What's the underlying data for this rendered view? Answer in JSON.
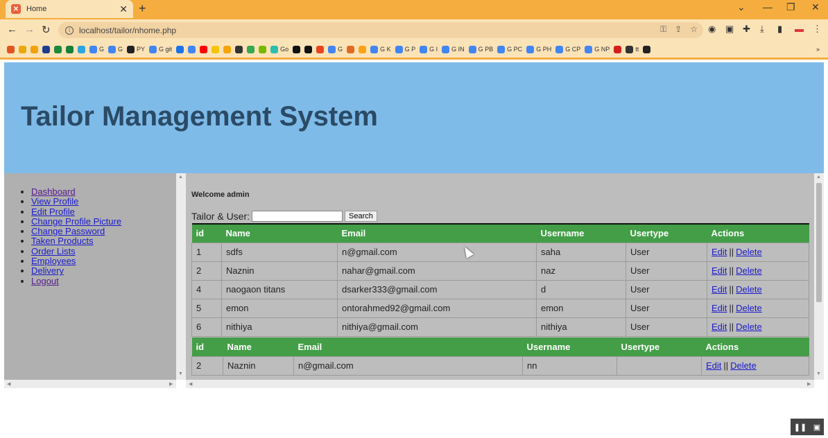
{
  "browser": {
    "tab_title": "Home",
    "tab_favicon": "xampp-icon",
    "url": "localhost/tailor/nhome.php",
    "bookmarks": [
      {
        "label": "",
        "color": "#e2531f"
      },
      {
        "label": "",
        "color": "#e9a90c"
      },
      {
        "label": "",
        "color": "#f2a20c"
      },
      {
        "label": "",
        "color": "#1d3d8f"
      },
      {
        "label": "",
        "color": "#1b8a3a"
      },
      {
        "label": "",
        "color": "#188038"
      },
      {
        "label": "",
        "color": "#2ca5e0"
      },
      {
        "label": "G",
        "color": "#4285f4"
      },
      {
        "label": "G",
        "color": "#4285f4"
      },
      {
        "label": "PY",
        "color": "#222222"
      },
      {
        "label": "G git",
        "color": "#4285f4"
      },
      {
        "label": "",
        "color": "#1a73e8"
      },
      {
        "label": "",
        "color": "#4285f4"
      },
      {
        "label": "",
        "color": "#ff0000"
      },
      {
        "label": "",
        "color": "#f5c400"
      },
      {
        "label": "",
        "color": "#f7a400"
      },
      {
        "label": "",
        "color": "#333333"
      },
      {
        "label": "",
        "color": "#34a853"
      },
      {
        "label": "",
        "color": "#76b900"
      },
      {
        "label": "Go",
        "color": "#29beb0"
      },
      {
        "label": "",
        "color": "#111111"
      },
      {
        "label": "",
        "color": "#111111"
      },
      {
        "label": "",
        "color": "#e9441c"
      },
      {
        "label": "G",
        "color": "#4285f4"
      },
      {
        "label": "",
        "color": "#e06a24"
      },
      {
        "label": "",
        "color": "#ffa116"
      },
      {
        "label": "G K",
        "color": "#4285f4"
      },
      {
        "label": "G P",
        "color": "#4285f4"
      },
      {
        "label": "G I",
        "color": "#4285f4"
      },
      {
        "label": "G IN",
        "color": "#4285f4"
      },
      {
        "label": "G PB",
        "color": "#4285f4"
      },
      {
        "label": "G PC",
        "color": "#4285f4"
      },
      {
        "label": "G PH",
        "color": "#4285f4"
      },
      {
        "label": "G CP",
        "color": "#4285f4"
      },
      {
        "label": "G NP",
        "color": "#4285f4"
      },
      {
        "label": "",
        "color": "#d41f1f"
      },
      {
        "label": "tt",
        "color": "#333333"
      },
      {
        "label": "",
        "color": "#222222"
      }
    ],
    "more_bookmarks": "»"
  },
  "header": {
    "title": "Tailor Management System"
  },
  "sidebar": {
    "items": [
      {
        "label": "Dashboard",
        "visited": true
      },
      {
        "label": "View Profile",
        "visited": false
      },
      {
        "label": "Edit Profile",
        "visited": false
      },
      {
        "label": "Change Profile Picture",
        "visited": false
      },
      {
        "label": "Change Password",
        "visited": false
      },
      {
        "label": "Taken Products",
        "visited": false
      },
      {
        "label": "Order Lists",
        "visited": false
      },
      {
        "label": "Employees",
        "visited": false
      },
      {
        "label": "Delivery",
        "visited": false
      },
      {
        "label": "Logout",
        "visited": true
      }
    ]
  },
  "main": {
    "welcome": "Welcome admin",
    "search_label": "Tailor & User:",
    "search_value": "",
    "search_button": "Search",
    "users_table": {
      "columns": [
        "id",
        "Name",
        "Email",
        "Username",
        "Usertype",
        "Actions"
      ],
      "rows": [
        [
          "1",
          "sdfs",
          "n@gmail.com",
          "saha",
          "User"
        ],
        [
          "2",
          "Naznin",
          "nahar@gmail.com",
          "naz",
          "User"
        ],
        [
          "4",
          "naogaon titans",
          "dsarker333@gmail.com",
          "d",
          "User"
        ],
        [
          "5",
          "emon",
          "ontorahmed92@gmail.com",
          "emon",
          "User"
        ],
        [
          "6",
          "nithiya",
          "nithiya@gmail.com",
          "nithiya",
          "User"
        ]
      ]
    },
    "tailors_table": {
      "columns": [
        "id",
        "Name",
        "Email",
        "Username",
        "Usertype",
        "Actions"
      ],
      "rows": [
        [
          "2",
          "Naznin",
          "n@gmail.com",
          "nn",
          ""
        ]
      ]
    },
    "edit_label": "Edit",
    "separator": "||",
    "delete_label": "Delete"
  },
  "colors": {
    "browser_frame": "#f6ad3f",
    "hero_bg": "#7fbbe8",
    "title_color": "#2a4a66",
    "sidebar_bg": "#b0b0b0",
    "main_bg": "#bdbdbd",
    "table_header": "#439e47"
  }
}
